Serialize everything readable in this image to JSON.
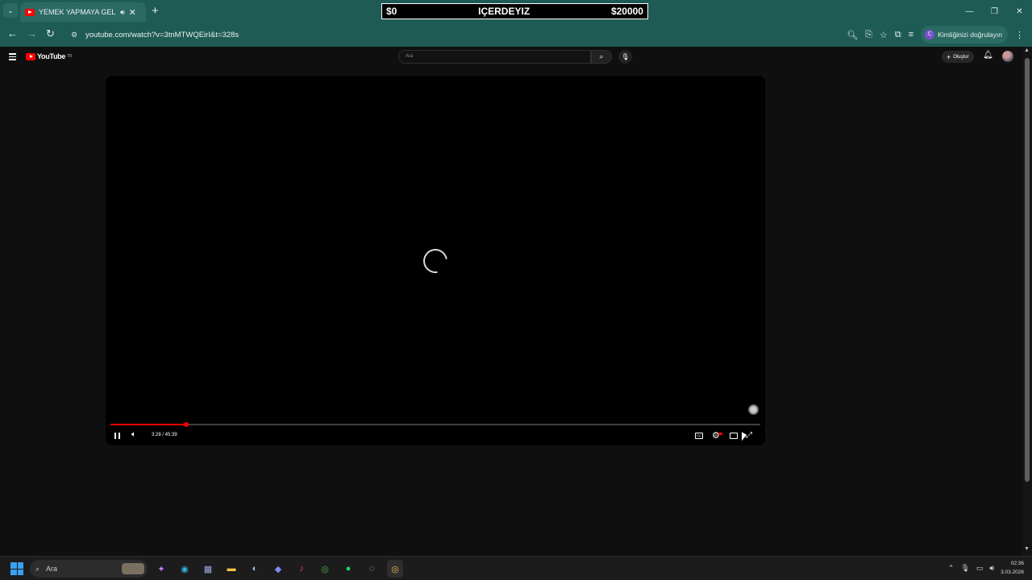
{
  "browser": {
    "tab_title": "YEMEK YAPMAYA GELDİK, D",
    "url": "youtube.com/watch?v=3tnMTWQEirI&t=328s",
    "verify_label": "Kimliğinizi doğrulayın",
    "verify_initial": "C"
  },
  "stream_overlay": {
    "left": "$0",
    "center": "IÇERDEYIZ",
    "right": "$20000"
  },
  "youtube": {
    "logo_text": "YouTube",
    "logo_country": "TR",
    "search_placeholder": "Ara",
    "create_label": "Oluştur"
  },
  "player": {
    "time_display": "3:28 / 45:39",
    "progress_fraction": 0.117
  },
  "taskbar": {
    "search_label": "Ara",
    "clock_time": "02:36",
    "clock_date": "3.03.2026"
  },
  "icons": {
    "tab_search": "chevron-down-icon",
    "back": "back-arrow-icon",
    "forward": "forward-arrow-icon",
    "reload": "reload-icon"
  }
}
